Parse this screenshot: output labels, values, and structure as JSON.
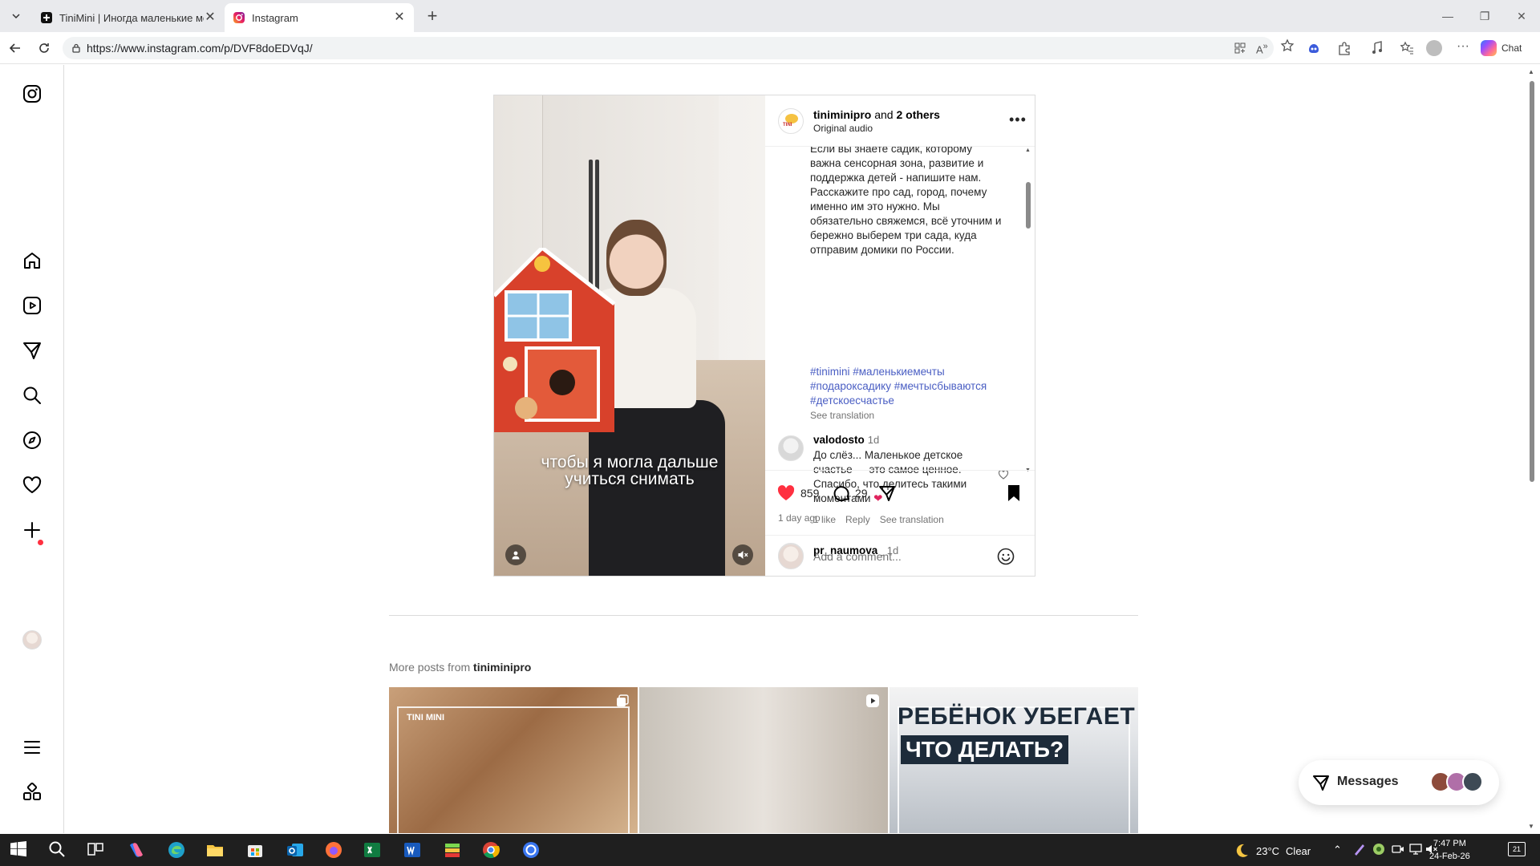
{
  "browser": {
    "tabs": [
      {
        "title": "TiniMini | Иногда маленькие мечты",
        "icon": "tinimini-favicon",
        "active": false
      },
      {
        "title": "Instagram",
        "icon": "instagram-favicon",
        "active": true
      }
    ],
    "url": "https://www.instagram.com/p/DVF8doEDVqJ/",
    "chat_label": "Chat"
  },
  "rail": {
    "items": [
      "instagram-logo",
      "home",
      "reels",
      "messages",
      "search",
      "explore",
      "notifications",
      "create",
      "profile",
      "more",
      "also-from-meta"
    ]
  },
  "post": {
    "author": "tiniminipro",
    "author_suffix_and": "and",
    "author_suffix_others": "2 others",
    "audio": "Original audio",
    "video_caption_line1": "чтобы я могла дальше",
    "video_caption_line2": "учиться снимать",
    "caption_lines": [
      "Если вы знаете садик, которому",
      "важна сенсорная зона, развитие и",
      "поддержка детей - напишите нам.",
      "Расскажите про сад, город, почему",
      "именно им это нужно. Мы",
      "обязательно свяжемся, всё уточним и",
      "бережно выберем три сада, куда",
      "отправим домики по России."
    ],
    "hashtags_line1": "#tinimini #маленькиемечты",
    "hashtags_line2": "#подароксадику #мечтысбываются",
    "hashtags_line3": "#детскоесчастье",
    "see_translation": "See translation",
    "comments": [
      {
        "user": "valodosto",
        "time": "1d",
        "lines": [
          "До слёз... Маленькое детское",
          "счастье — это самое ценное.",
          "Спасибо, что делитесь такими",
          "моментами"
        ],
        "likes": "1 like",
        "reply": "Reply",
        "translate": "See translation"
      },
      {
        "user": "pr_naumova_",
        "time": "1d"
      }
    ],
    "like_count": "859",
    "comment_count": "29",
    "posted": "1 day ago",
    "add_comment_placeholder": "Add a comment..."
  },
  "more_posts": {
    "prefix": "More posts from",
    "user": "tiniminipro",
    "thumb3_line1": "РЕБЁНОК УБЕГАЕТ",
    "thumb3_line2": "ЧТО ДЕЛАТЬ?",
    "thumb1_brand": "TINI MINI"
  },
  "messages": {
    "label": "Messages"
  },
  "taskbar": {
    "weather_temp": "23°C",
    "weather_desc": "Clear",
    "time": "7:47 PM",
    "date": "24-Feb-26",
    "notifications": "21"
  },
  "colors": {
    "like_red": "#ff3040",
    "hashtag_blue": "#4a5ec3",
    "taskbar": "#1f1f1f"
  }
}
